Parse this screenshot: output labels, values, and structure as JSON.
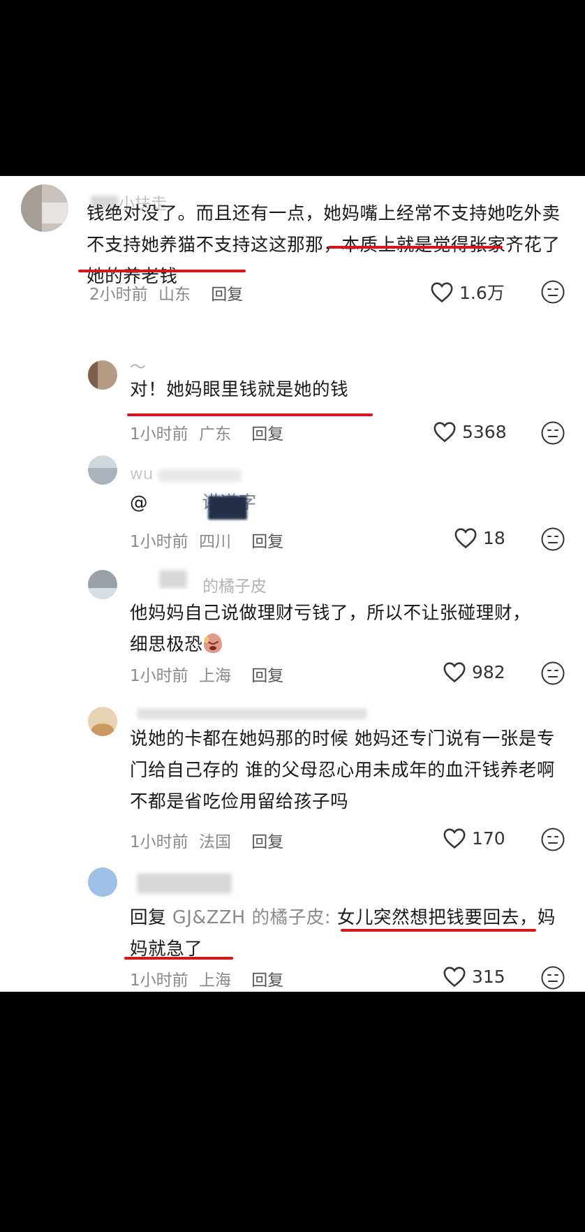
{
  "comments": [
    {
      "username": "小扶走",
      "text": "钱绝对没了。而且还有一点，她妈嘴上经常不支持她吃外卖不支持她养猫不支持这这那那，本质上就是觉得张家齐花了她的养老钱",
      "time": "2小时前",
      "location": "山东",
      "reply": "回复",
      "likes": "1.6万"
    },
    {
      "username": "～",
      "text": "对！她妈眼里钱就是她的钱",
      "time": "1小时前",
      "location": "广东",
      "reply": "回复",
      "likes": "5368"
    },
    {
      "username": "wu",
      "text": "@",
      "text_tail": "讲道字",
      "time": "1小时前",
      "location": "四川",
      "reply": "回复",
      "likes": "18"
    },
    {
      "username": "的橘子皮",
      "text": "他妈妈自己说做理财亏钱了，所以不让张碰理财，细思极恐",
      "time": "1小时前",
      "location": "上海",
      "reply": "回复",
      "likes": "982"
    },
    {
      "username": "",
      "text": "说她的卡都在她妈那的时候 她妈还专门说有一张是专门给自己存的 谁的父母忍心用未成年的血汗钱养老啊 不都是省吃俭用留给孩子吗",
      "time": "1小时前",
      "location": "法国",
      "reply": "回复",
      "likes": "170"
    },
    {
      "username": "",
      "reply_prefix": "回复",
      "reply_target": "GJ&ZZH 的橘子皮:",
      "text": "女儿突然想把钱要回去，妈妈就急了",
      "time": "1小时前",
      "location": "上海",
      "reply": "回复",
      "likes": "315"
    }
  ],
  "colors": {
    "underline": "#d6161c",
    "meta": "#8a8a8a",
    "text": "#1a1a1a"
  },
  "icons": {
    "like": "heart-outline-icon",
    "more": "neutral-face-icon"
  }
}
